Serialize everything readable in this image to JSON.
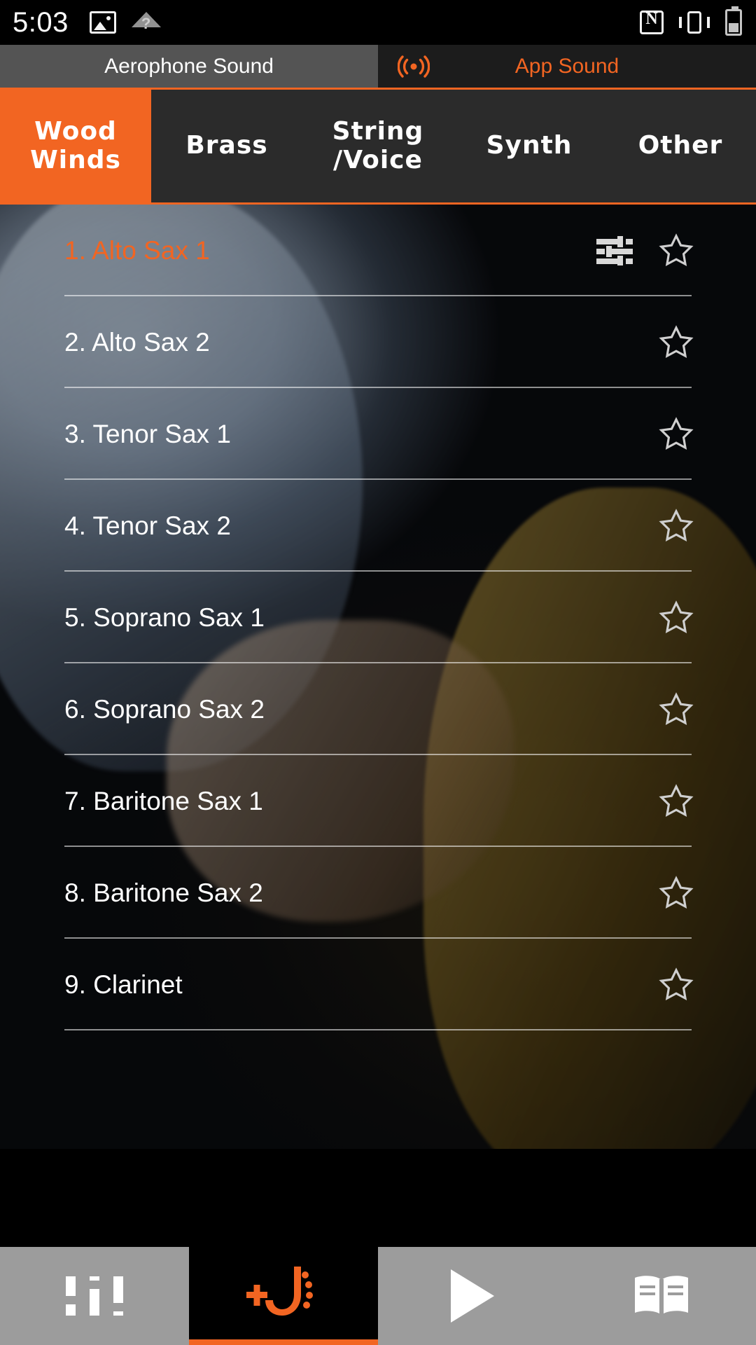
{
  "status_bar": {
    "time": "5:03",
    "left_icons": [
      "image-icon",
      "wifi-question-icon"
    ],
    "right_icons": [
      "nfc-icon",
      "vibrate-icon",
      "battery-icon"
    ],
    "battery_level": "42%"
  },
  "source_tabs": [
    {
      "label": "Aerophone Sound",
      "active": false,
      "icon": ""
    },
    {
      "label": "App Sound",
      "active": true,
      "icon": "broadcast-icon"
    }
  ],
  "category_tabs": [
    {
      "label": "Wood\nWinds",
      "active": true
    },
    {
      "label": "Brass",
      "active": false
    },
    {
      "label": "String\n/Voice",
      "active": false
    },
    {
      "label": "Synth",
      "active": false
    },
    {
      "label": "Other",
      "active": false
    }
  ],
  "sound_list": [
    {
      "label": "1. Alto Sax 1",
      "selected": true,
      "has_mixer": true,
      "favorite": false
    },
    {
      "label": "2. Alto Sax 2",
      "selected": false,
      "has_mixer": false,
      "favorite": false
    },
    {
      "label": "3. Tenor Sax 1",
      "selected": false,
      "has_mixer": false,
      "favorite": false
    },
    {
      "label": "4. Tenor Sax 2",
      "selected": false,
      "has_mixer": false,
      "favorite": false
    },
    {
      "label": "5. Soprano Sax 1",
      "selected": false,
      "has_mixer": false,
      "favorite": false
    },
    {
      "label": "6. Soprano Sax 2",
      "selected": false,
      "has_mixer": false,
      "favorite": false
    },
    {
      "label": "7. Baritone Sax 1",
      "selected": false,
      "has_mixer": false,
      "favorite": false
    },
    {
      "label": "8. Baritone Sax 2",
      "selected": false,
      "has_mixer": false,
      "favorite": false
    },
    {
      "label": "9. Clarinet",
      "selected": false,
      "has_mixer": false,
      "favorite": false
    }
  ],
  "bottom_bar": [
    {
      "name": "mixer-tab",
      "icon": "sliders-icon",
      "active": false
    },
    {
      "name": "sound-tab",
      "icon": "sax-plus-icon",
      "active": true
    },
    {
      "name": "play-tab",
      "icon": "play-icon",
      "active": false
    },
    {
      "name": "manual-tab",
      "icon": "book-icon",
      "active": false
    }
  ],
  "colors": {
    "accent": "#F26522",
    "tab_inactive_bg": "#545454",
    "cat_bar_bg": "#2b2b2b",
    "bottom_bar_bg": "#9c9c9c",
    "text": "#ffffff"
  }
}
